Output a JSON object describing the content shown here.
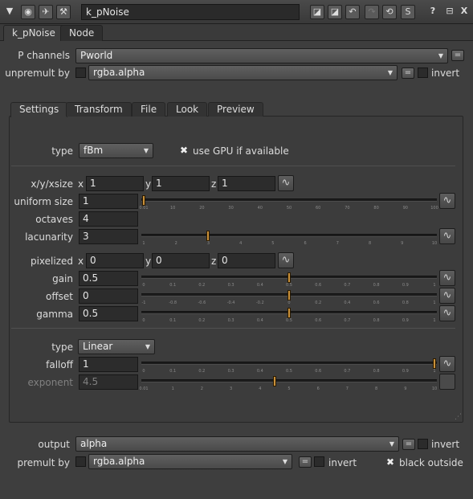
{
  "titlebar": {
    "collapse_icon": "triangle-down-icon",
    "node_name": "k_pNoise",
    "help_label": "?",
    "float_label": "⊟",
    "close_label": "X",
    "s_label": "S"
  },
  "node_tabs": [
    "k_pNoise",
    "Node"
  ],
  "top": {
    "p_channels_label": "P channels",
    "p_channels_value": "Pworld",
    "unpremult_label": "unpremult by",
    "unpremult_value": "rgba.alpha",
    "invert_label": "invert",
    "eq_label": "="
  },
  "sub_tabs": [
    "Settings",
    "Transform",
    "File",
    "Look",
    "Preview"
  ],
  "settings": {
    "type_label": "type",
    "type_value": "fBm",
    "gpu_label": "use GPU if available",
    "xyz_size_label": "x/y/xsize",
    "axis_x": "x",
    "axis_y": "y",
    "axis_z": "z",
    "xsize": "1",
    "ysize": "1",
    "zsize": "1",
    "uniform_size_label": "uniform size",
    "uniform_size": "1",
    "octaves_label": "octaves",
    "octaves": "4",
    "lacunarity_label": "lacunarity",
    "lacunarity": "3",
    "pixelized_label": "pixelized",
    "pix_x": "0",
    "pix_y": "0",
    "pix_z": "0",
    "gain_label": "gain",
    "gain": "0.5",
    "offset_label": "offset",
    "offset": "0",
    "gamma_label": "gamma",
    "gamma": "0.5",
    "falloff_type_label": "type",
    "falloff_type_value": "Linear",
    "falloff_label": "falloff",
    "falloff": "1",
    "exponent_label": "exponent",
    "exponent": "4.5"
  },
  "sliders": {
    "uniform_size": {
      "ticks": [
        "0.01",
        "10",
        "20",
        "30",
        "40",
        "50",
        "60",
        "70",
        "80",
        "90",
        "100"
      ],
      "value_frac": 0.0
    },
    "lacunarity": {
      "ticks": [
        "1",
        "2",
        "3",
        "4",
        "5",
        "6",
        "7",
        "8",
        "9",
        "10"
      ],
      "value_frac": 0.222
    },
    "gain": {
      "ticks": [
        "0",
        "0.1",
        "0.2",
        "0.3",
        "0.4",
        "0.5",
        "0.6",
        "0.7",
        "0.8",
        "0.9",
        "1"
      ],
      "value_frac": 0.5
    },
    "offset": {
      "ticks": [
        "-1",
        "-0.8",
        "-0.6",
        "-0.4",
        "-0.2",
        "0",
        "0.2",
        "0.4",
        "0.6",
        "0.8",
        "1"
      ],
      "value_frac": 0.5
    },
    "gamma": {
      "ticks": [
        "0",
        "0.1",
        "0.2",
        "0.3",
        "0.4",
        "0.5",
        "0.6",
        "0.7",
        "0.8",
        "0.9",
        "1"
      ],
      "value_frac": 0.5
    },
    "falloff": {
      "ticks": [
        "0",
        "0.1",
        "0.2",
        "0.3",
        "0.4",
        "0.5",
        "0.6",
        "0.7",
        "0.8",
        "0.9",
        "1"
      ],
      "value_frac": 1.0
    },
    "exponent": {
      "ticks": [
        "0.01",
        "1",
        "2",
        "3",
        "4",
        "5",
        "6",
        "7",
        "8",
        "9",
        "10"
      ],
      "value_frac": 0.45
    }
  },
  "bottom": {
    "output_label": "output",
    "output_value": "alpha",
    "premult_label": "premult by",
    "premult_value": "rgba.alpha",
    "invert_label": "invert",
    "invert2_label": "invert",
    "black_outside_label": "black outside",
    "eq_label": "="
  },
  "colors": {
    "handle": "#c8903a",
    "panel": "#3e3e3e"
  }
}
